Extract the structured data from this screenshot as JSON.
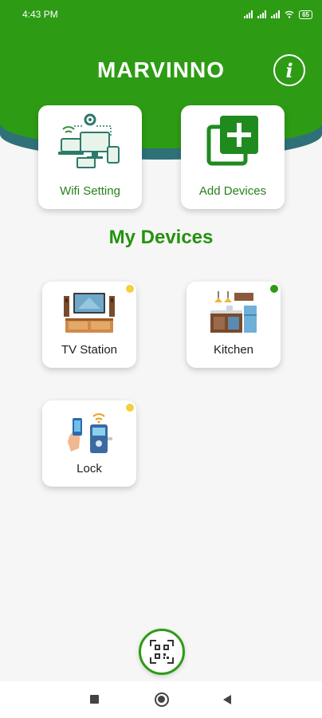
{
  "status_bar": {
    "time": "4:43 PM",
    "battery": "65"
  },
  "header": {
    "title": "MARVINNO",
    "info_glyph": "i"
  },
  "quick_actions": {
    "wifi_label": "Wifi Setting",
    "add_label": "Add Devices"
  },
  "section_title": "My Devices",
  "devices": [
    {
      "label": "TV Station",
      "status_color": "#f3d03c"
    },
    {
      "label": "Kitchen",
      "status_color": "#2e9b15"
    },
    {
      "label": "Lock",
      "status_color": "#f3d03c"
    }
  ],
  "colors": {
    "brand_green": "#2e9b15",
    "teal": "#2f7178",
    "status_idle": "#f3d03c",
    "status_online": "#2e9b15"
  },
  "icons": {
    "wifi_setting": "wifi-devices-icon",
    "add_devices": "add-square-icon",
    "tv_station": "tv-station-icon",
    "kitchen": "kitchen-icon",
    "lock": "smart-lock-icon",
    "qr": "qr-code-icon",
    "info": "info-icon"
  }
}
